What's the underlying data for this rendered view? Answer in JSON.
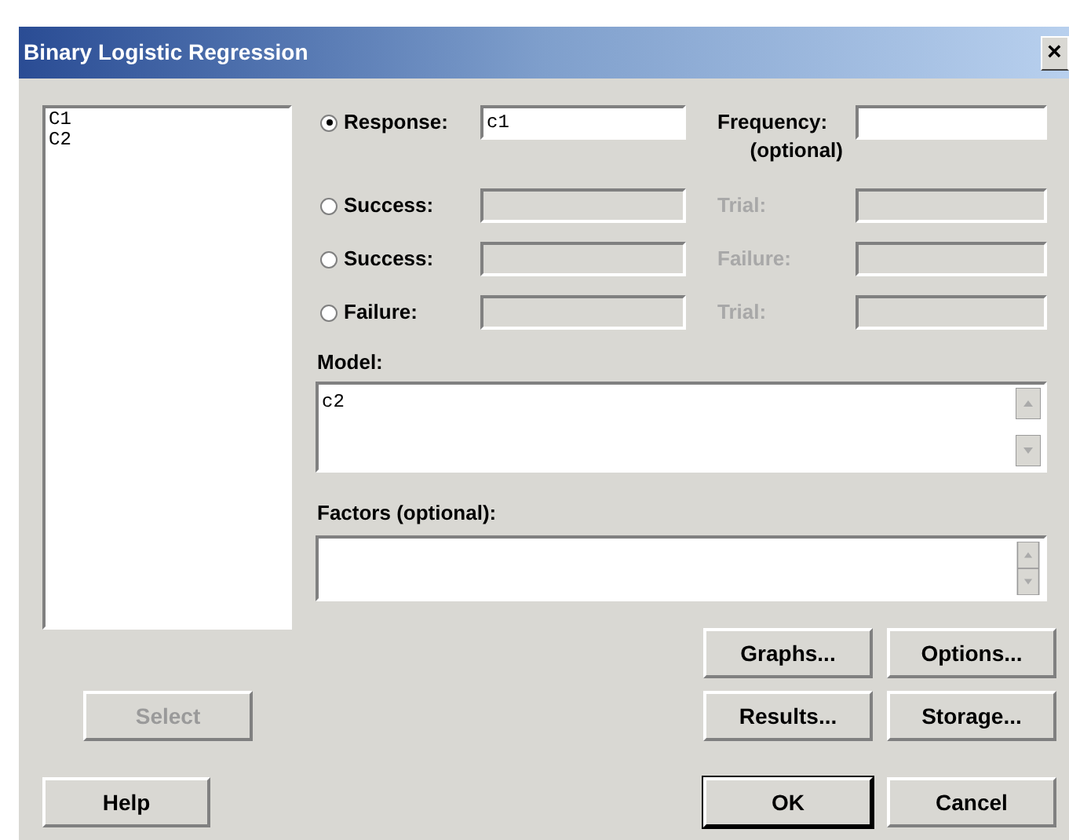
{
  "window": {
    "title": "Binary Logistic Regression",
    "close": "×"
  },
  "variables": [
    "C1",
    "C2"
  ],
  "rows": [
    {
      "label": "Response:",
      "selected": true,
      "value": "c1",
      "disabled": false,
      "side_label": "Frequency:",
      "side_note": "(optional)",
      "side_disabled": false
    },
    {
      "label": "Success:",
      "selected": false,
      "disabled": true,
      "side_label": "Trial:",
      "side_disabled": true
    },
    {
      "label": "Success:",
      "selected": false,
      "disabled": true,
      "side_label": "Failure:",
      "side_disabled": true
    },
    {
      "label": "Failure:",
      "selected": false,
      "disabled": true,
      "side_label": "Trial:",
      "side_disabled": true
    }
  ],
  "model": {
    "label": "Model:",
    "value": "c2"
  },
  "factors": {
    "label": "Factors (optional):"
  },
  "select_button": {
    "label": "Select",
    "disabled": true
  },
  "help_button": "Help",
  "option_buttons": [
    "Graphs...",
    "Options...",
    "Results...",
    "Storage..."
  ],
  "ok_button": {
    "label": "OK",
    "default": true
  },
  "cancel_button": "Cancel"
}
